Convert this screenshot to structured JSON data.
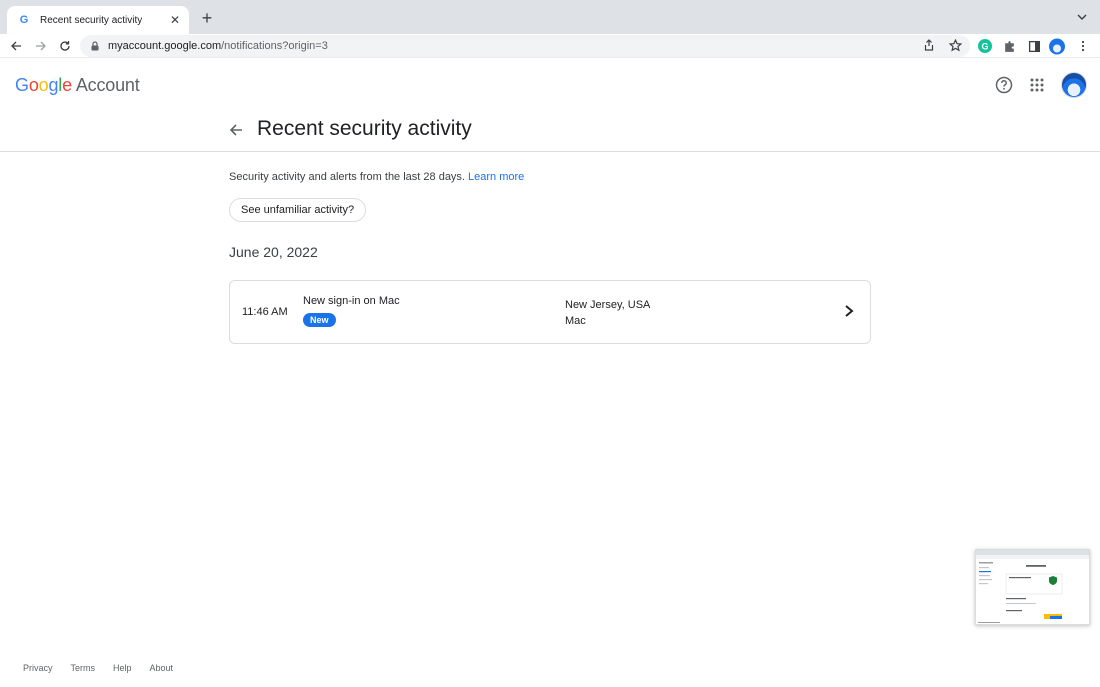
{
  "browser": {
    "tab_title": "Recent security activity",
    "tab_favicon": "G",
    "new_tab_label": "+",
    "url_host": "myaccount.google.com",
    "url_path": "/notifications?origin=3"
  },
  "header": {
    "logo_google": [
      "G",
      "o",
      "o",
      "g",
      "l",
      "e"
    ],
    "logo_colors": [
      "#4285f4",
      "#ea4335",
      "#fbbc05",
      "#4285f4",
      "#34a853",
      "#ea4335"
    ],
    "logo_account": "Account"
  },
  "page": {
    "title": "Recent security activity",
    "intro_text": "Security activity and alerts from the last 28 days.",
    "learn_more": "Learn more",
    "unfamiliar_button": "See unfamiliar activity?",
    "date_heading": "June 20, 2022"
  },
  "activity": [
    {
      "time": "11:46 AM",
      "event": "New sign-in on Mac",
      "badge": "New",
      "location": "New Jersey, USA",
      "device": "Mac"
    }
  ],
  "footer": {
    "links": [
      "Privacy",
      "Terms",
      "Help",
      "About"
    ]
  },
  "colors": {
    "accent": "#1a73e8",
    "border": "#dadce0"
  }
}
